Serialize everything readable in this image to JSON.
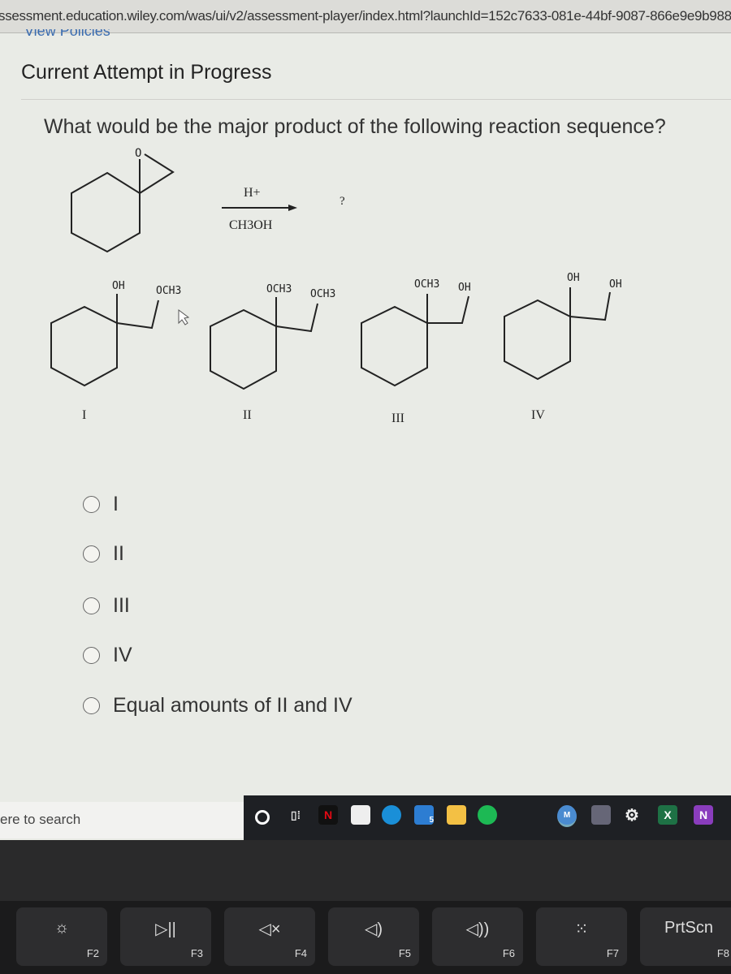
{
  "browser": {
    "url": "ssessment.education.wiley.com/was/ui/v2/assessment-player/index.html?launchId=152c7633-081e-44bf-9087-866e9e9b988"
  },
  "page": {
    "policies_link": "View Policies",
    "attempt_heading": "Current Attempt in Progress",
    "question": "What would be the major product of the following reaction sequence?"
  },
  "reaction": {
    "reactant_atom": "O",
    "reagent_top": "H+",
    "reagent_bottom": "CH3OH",
    "product": "?"
  },
  "structures": [
    {
      "label": "I",
      "group1": "OH",
      "group2": "OCH3"
    },
    {
      "label": "II",
      "group1": "OCH3",
      "group2": "OCH3"
    },
    {
      "label": "III",
      "group1": "OCH3",
      "group2": "OH"
    },
    {
      "label": "IV",
      "group1": "OH",
      "group2": "OH"
    }
  ],
  "options": [
    {
      "label": "I",
      "selected": false
    },
    {
      "label": "II",
      "selected": false
    },
    {
      "label": "III",
      "selected": false
    },
    {
      "label": "IV",
      "selected": false
    },
    {
      "label": "Equal amounts of II and IV",
      "selected": false
    }
  ],
  "taskbar": {
    "search_placeholder": "ere to search",
    "icons": [
      "cortana-icon",
      "task-view-icon",
      "netflix-icon",
      "store-icon",
      "edge-icon",
      "mail-icon",
      "file-explorer-icon",
      "spotify-icon",
      "chrome-icon",
      "camera-icon",
      "settings-icon",
      "excel-icon",
      "onenote-icon"
    ],
    "netflix_letter": "N",
    "mail_badge": "5",
    "chrome_badge": "M",
    "excel_letter": "X",
    "onenote_letter": "N"
  },
  "keyboard": [
    {
      "glyph": "☼",
      "fn": "F2"
    },
    {
      "glyph": "▷||",
      "fn": "F3"
    },
    {
      "glyph": "◁×",
      "fn": "F4"
    },
    {
      "glyph": "◁)",
      "fn": "F5"
    },
    {
      "glyph": "◁))",
      "fn": "F6"
    },
    {
      "glyph": "⁙",
      "fn": "F7"
    },
    {
      "glyph": "PrtScn",
      "fn": "F8"
    }
  ]
}
